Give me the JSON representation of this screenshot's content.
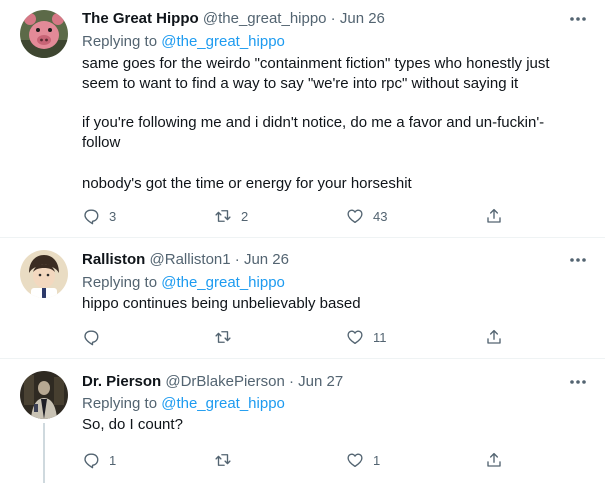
{
  "tweets": [
    {
      "name": "The Great Hippo",
      "handle": "@the_great_hippo",
      "sep": " · ",
      "date": "Jun 26",
      "replying_prefix": "Replying to ",
      "replying_to": "@the_great_hippo",
      "lines": [
        "same goes for the weirdo \"containment fiction\" types who honestly just",
        "seem to want to find a way to say \"we're into rpc\" without saying it",
        "if you're following me and i didn't notice, do me a favor and un-fuckin'-",
        "follow",
        "nobody's got the time or energy for your horseshit"
      ],
      "counts": {
        "reply": "3",
        "retweet": "2",
        "like": "43"
      },
      "avatar_colors": {
        "bg": "#5c6a48",
        "face": "#e38a98"
      }
    },
    {
      "name": "Ralliston",
      "handle": "@Ralliston1",
      "sep": " · ",
      "date": "Jun 26",
      "replying_prefix": "Replying to ",
      "replying_to": "@the_great_hippo",
      "lines": [
        "hippo continues being unbelievably based"
      ],
      "counts": {
        "reply": "",
        "retweet": "",
        "like": "11"
      },
      "avatar_colors": {
        "bg": "#e9dcc3",
        "face": "#f3d8bf"
      }
    },
    {
      "name": "Dr. Pierson",
      "handle": "@DrBlakePierson",
      "sep": " · ",
      "date": "Jun 27",
      "replying_prefix": "Replying to ",
      "replying_to": "@the_great_hippo",
      "lines": [
        "So, do I count?"
      ],
      "counts": {
        "reply": "1",
        "retweet": "",
        "like": "1"
      },
      "avatar_colors": {
        "bg": "#2f2a22",
        "face": "#c8c2b4"
      }
    }
  ],
  "icons": {
    "reply": "reply-icon",
    "retweet": "retweet-icon",
    "like": "like-icon",
    "share": "share-icon",
    "more": "more-icon"
  },
  "colors": {
    "mention": "#1d9bf0",
    "secondary_text": "#536471",
    "primary_text": "#0f1419",
    "divider": "#eff3f4",
    "thread_line": "#cfd9de"
  }
}
